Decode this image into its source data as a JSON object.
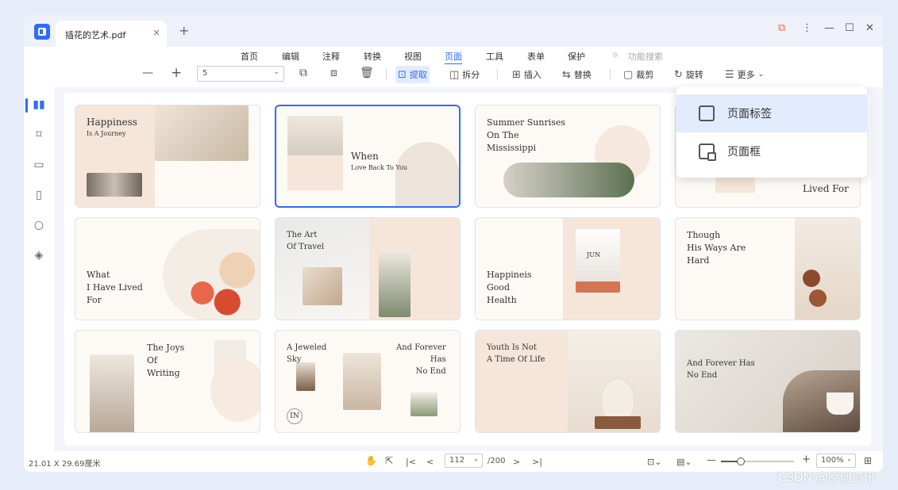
{
  "tab": {
    "title": "插花的艺术.pdf",
    "close": "×",
    "add": "+"
  },
  "window_controls": {
    "notify": "⧉",
    "more": "⋮",
    "minimize": "—",
    "maximize": "☐",
    "close": "✕"
  },
  "menu": [
    {
      "label": "首页"
    },
    {
      "label": "编辑"
    },
    {
      "label": "注释"
    },
    {
      "label": "转换"
    },
    {
      "label": "视图"
    },
    {
      "label": "页面"
    },
    {
      "label": "工具"
    },
    {
      "label": "表单"
    },
    {
      "label": "保护"
    },
    {
      "label": "功能搜索"
    }
  ],
  "toolbar": {
    "zoom_out": "—",
    "zoom_in": "+",
    "page_value": "5",
    "extract": "提取",
    "split": "拆分",
    "insert": "插入",
    "replace": "替换",
    "crop": "裁剪",
    "rotate": "旋转",
    "more": "更多"
  },
  "dropdown": {
    "item1": "页面标签",
    "item2": "页面框"
  },
  "thumbs": [
    {
      "title": "Happiness",
      "sub": "Is A Journey"
    },
    {
      "title": "When",
      "sub": "Love Back To You"
    },
    {
      "title": "Summer Sunrises\nOn The\nMississippi"
    },
    {
      "title": "Lived For"
    },
    {
      "title": "What\nI Have Lived\nFor"
    },
    {
      "title": "The Art\nOf Travel"
    },
    {
      "title": "Happineis\nGood\nHealth",
      "tag": "JUN"
    },
    {
      "title": "Though\nHis Ways Are\nHard"
    },
    {
      "title": "The Joys\nOf\nWriting"
    },
    {
      "title": "A Jeweled\nSky",
      "title2": "And Forever\nHas\nNo End",
      "tag": "IN"
    },
    {
      "title": "Youth Is Not\nA Time Of Life"
    },
    {
      "title": "And Forever Has\nNo End"
    }
  ],
  "status": {
    "size": "21.01 X 29.69厘米",
    "page_current": "112",
    "page_total": "/200",
    "zoom": "100%"
  },
  "watermark": "CSDN @原创资讯",
  "colors": {
    "accent": "#2f6bff",
    "background": "#e6ecf8",
    "thumb_beige": "#f5e6d9"
  }
}
